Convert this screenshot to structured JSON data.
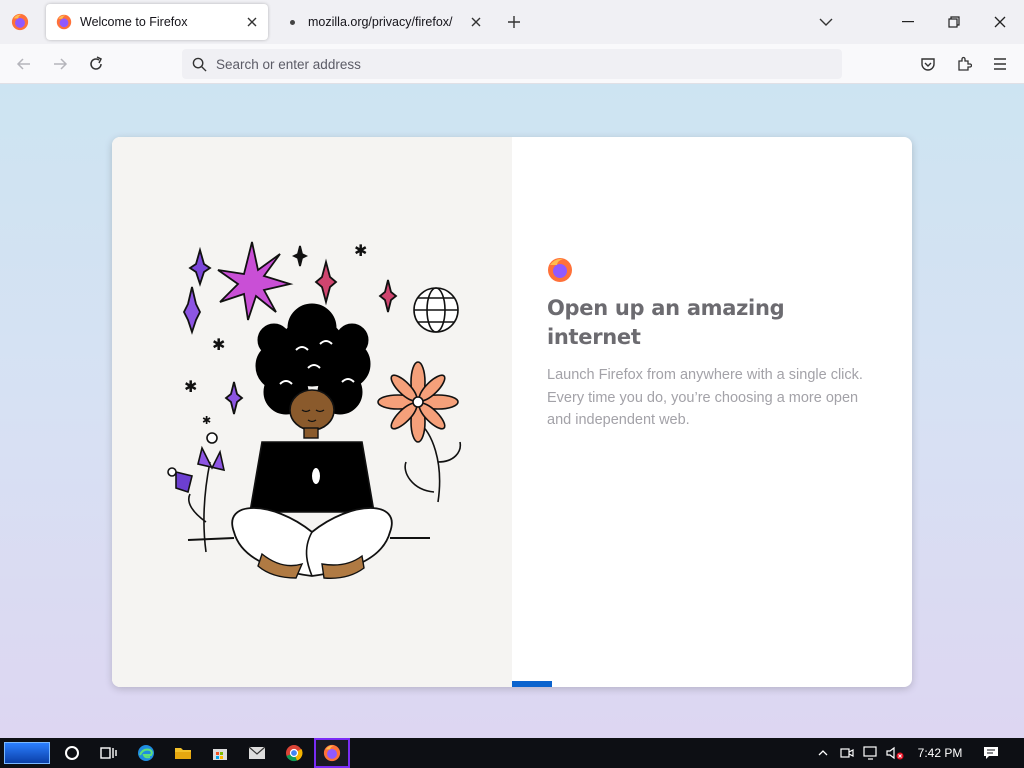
{
  "browser": {
    "tabs": [
      {
        "title": "Welcome to Firefox",
        "active": true
      },
      {
        "title": "mozilla.org/privacy/firefox/",
        "active": false
      }
    ],
    "urlbar": {
      "placeholder": "Search or enter address"
    }
  },
  "onboarding": {
    "heading": "Open up an amazing internet",
    "description": "Launch Firefox from anywhere with a single click. Every time you do, you’re choosing a more open and independent web.",
    "progress_step": 1
  },
  "taskbar": {
    "clock": "7:42 PM",
    "apps": [
      "cortana-icon",
      "task-view-icon",
      "edge-icon",
      "file-explorer-icon",
      "store-icon",
      "mail-icon",
      "chrome-icon",
      "firefox-icon"
    ]
  },
  "colors": {
    "accent": "#0b63ce",
    "heading": "#6c6b70",
    "description": "#a3a2a8",
    "taskbar": "#0d0f14"
  }
}
